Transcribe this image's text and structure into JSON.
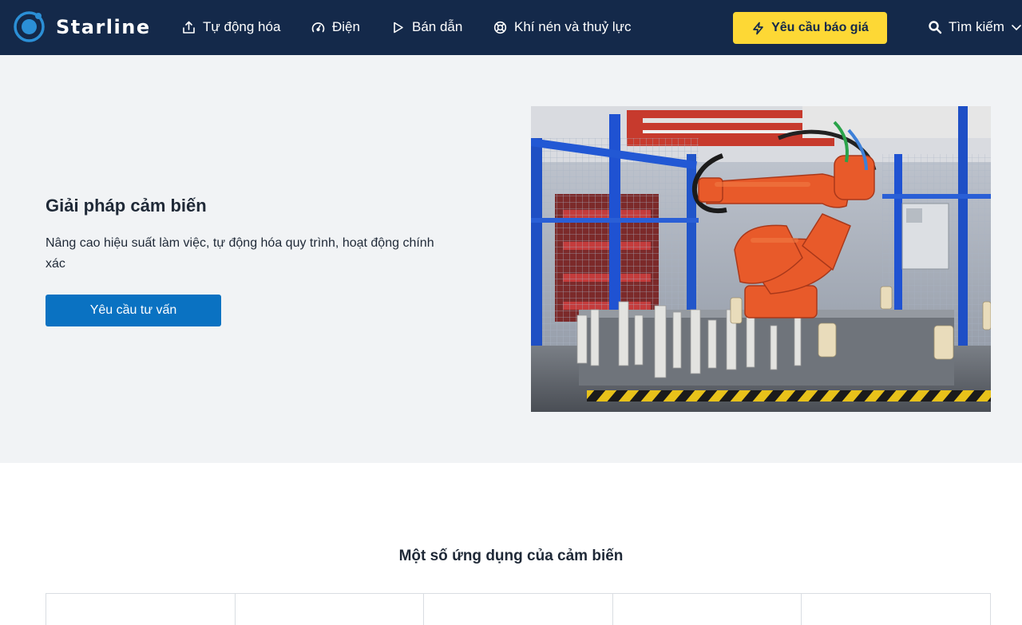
{
  "brand": {
    "name": "Starline",
    "logo_icon": "ring-dot-logo",
    "color": "#2b8fd6"
  },
  "nav": {
    "items": [
      {
        "label": "Tự động hóa",
        "icon": "upload-box-icon"
      },
      {
        "label": "Điện",
        "icon": "gauge-icon"
      },
      {
        "label": "Bán dẫn",
        "icon": "play-triangle-icon"
      },
      {
        "label": "Khí nén và thuỷ lực",
        "icon": "lifebuoy-icon"
      }
    ],
    "quote_button": {
      "label": "Yêu cầu báo giá",
      "icon": "lightning-icon"
    },
    "search": {
      "label": "Tìm kiếm",
      "icon": "search-icon"
    }
  },
  "hero": {
    "title": "Giải pháp cảm biến",
    "description": "Nâng cao hiệu suất làm việc, tự động hóa quy trình, hoạt động chính xác",
    "cta_label": "Yêu cầu tư vấn",
    "image_subject": "industrial-robot-arm-photo"
  },
  "applications": {
    "title": "Một số ứng dụng của cảm biến",
    "cards": [
      "",
      "",
      "",
      "",
      ""
    ]
  },
  "colors": {
    "navbar": "#14294a",
    "accent_yellow": "#fdd835",
    "primary_blue": "#0a72c2",
    "hero_bg": "#f1f3f5"
  }
}
